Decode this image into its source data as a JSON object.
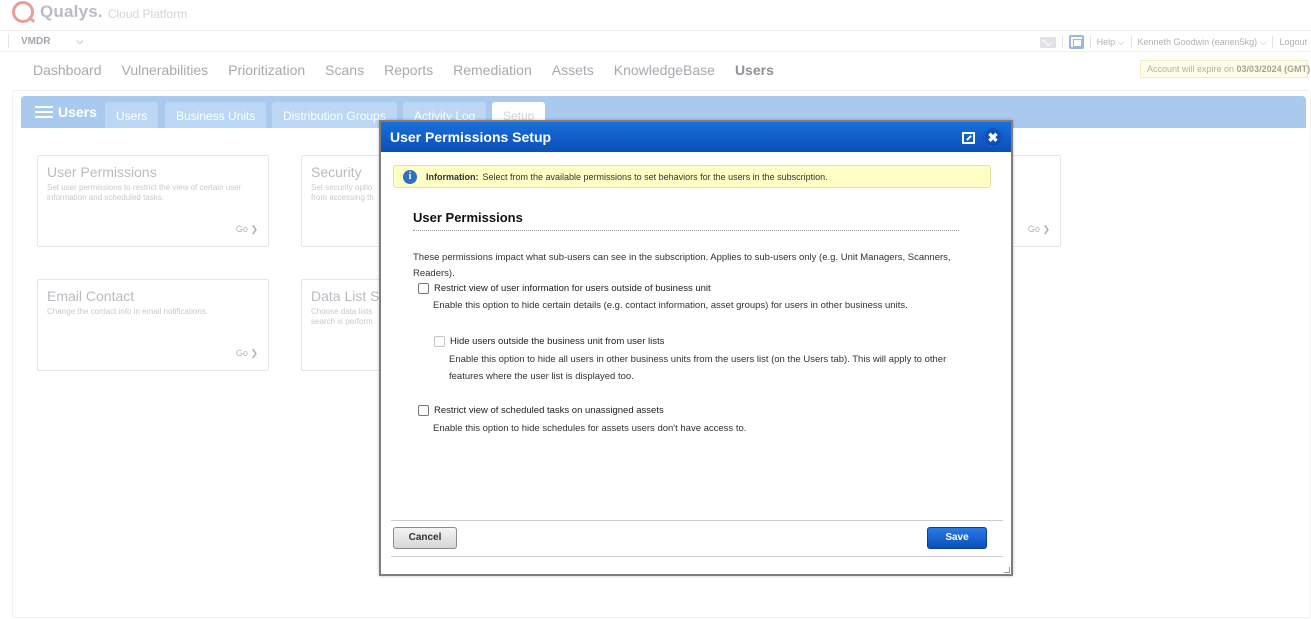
{
  "brand": {
    "name": "Qualys.",
    "product": "Cloud Platform"
  },
  "module": {
    "selected": "VMDR"
  },
  "top_tools": {
    "help": "Help",
    "user": "Kenneth Goodwin (eanen5kg)",
    "logout": "Logout"
  },
  "nav": {
    "items": [
      "Dashboard",
      "Vulnerabilities",
      "Prioritization",
      "Scans",
      "Reports",
      "Remediation",
      "Assets",
      "KnowledgeBase",
      "Users"
    ],
    "active_index": 8
  },
  "account_expire": {
    "prefix": "Account will expire on ",
    "date": "03/03/2024 (GMT)"
  },
  "app_tabs": {
    "title": "Users",
    "tabs": [
      "Users",
      "Business Units",
      "Distribution Groups",
      "Activity Log",
      "Setup"
    ],
    "selected": "Setup"
  },
  "cards": [
    {
      "title": "User Permissions",
      "desc": "Set user permissions to restrict the view of certain user information and scheduled tasks.",
      "go": "Go"
    },
    {
      "title": "Security",
      "desc": "Set security optio from accessing th",
      "go": ""
    },
    {
      "title": "Email Contact",
      "desc": "Change the contact info in email notifications.",
      "go": "Go"
    },
    {
      "title": "Data List S",
      "desc": "Choose data lists search is perform",
      "go": ""
    },
    {
      "title": "",
      "desc": "",
      "go": "Go"
    }
  ],
  "modal": {
    "title": "User Permissions Setup",
    "info_label": "Information:",
    "info_text": "Select from the available permissions to set behaviors for the users in the subscription.",
    "section_title": "User Permissions",
    "intro": "These permissions impact what sub-users can see in the subscription. Applies to sub-users only (e.g. Unit Managers, Scanners, Readers).",
    "options": [
      {
        "label": "Restrict view of user information for users outside of business unit",
        "desc": "Enable this option to hide certain details (e.g. contact information, asset groups) for users in other business units.",
        "checked": false,
        "disabled": false
      },
      {
        "label": "Hide users outside the business unit from user lists",
        "desc": "Enable this option to hide all users in other business units from the users list (on the Users tab). This will apply to other features where the user list is displayed too.",
        "checked": false,
        "disabled": true
      },
      {
        "label": "Restrict view of scheduled tasks on unassigned assets",
        "desc": "Enable this option to hide schedules for assets users don't have access to.",
        "checked": false,
        "disabled": false
      }
    ],
    "cancel_label": "Cancel",
    "save_label": "Save"
  }
}
